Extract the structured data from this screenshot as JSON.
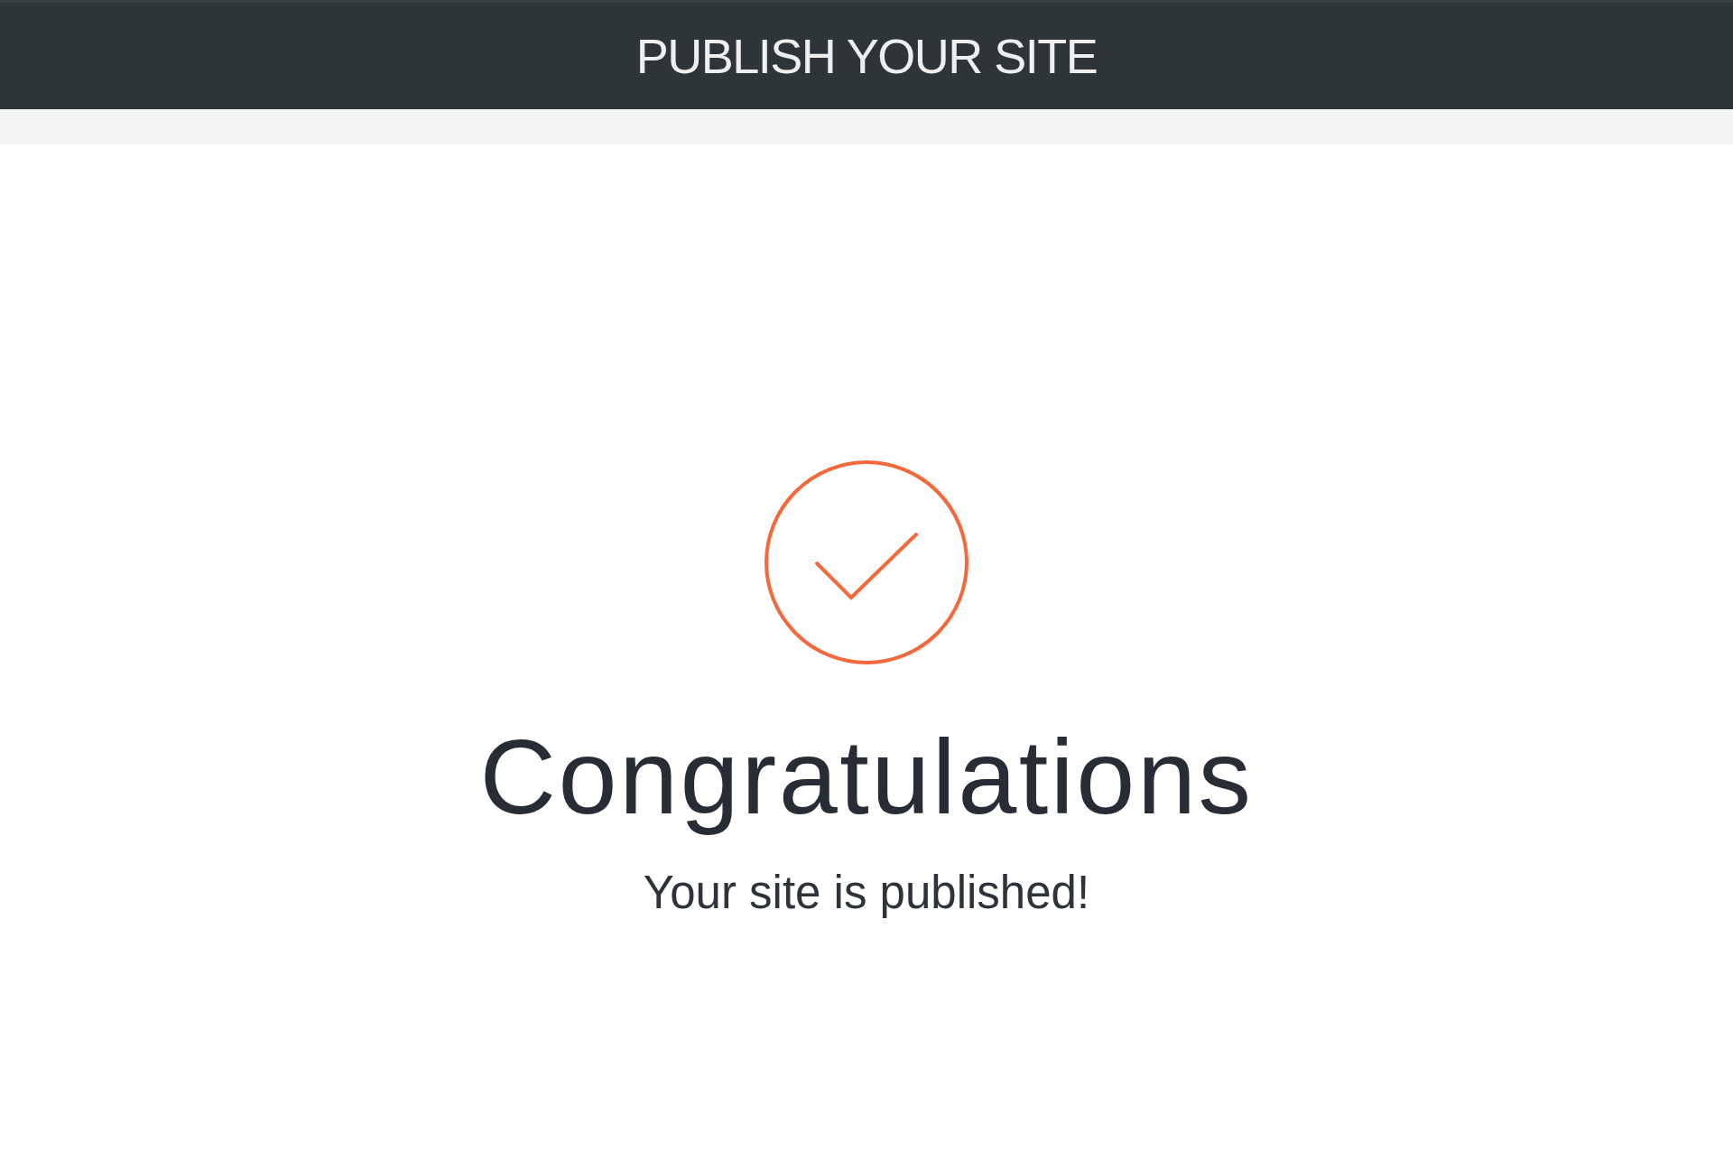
{
  "header": {
    "title": "PUBLISH YOUR SITE"
  },
  "confirmation": {
    "heading": "Congratulations",
    "message": "Your site is published!"
  }
}
